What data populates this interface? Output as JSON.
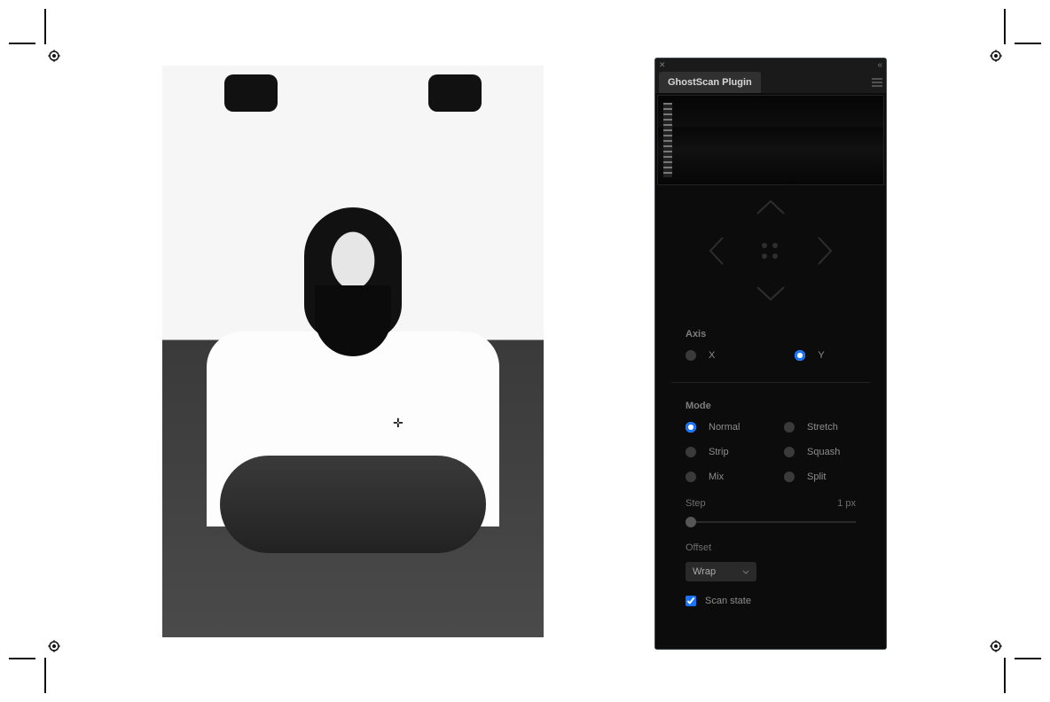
{
  "panel": {
    "title": "GhostScan Plugin",
    "axis": {
      "label": "Axis",
      "options": [
        "X",
        "Y"
      ],
      "selected": "Y"
    },
    "mode": {
      "label": "Mode",
      "options": [
        "Normal",
        "Stretch",
        "Strip",
        "Squash",
        "Mix",
        "Split"
      ],
      "selected": "Normal"
    },
    "step": {
      "label": "Step",
      "value": "1 px"
    },
    "offset": {
      "label": "Offset",
      "selectValue": "Wrap"
    },
    "scanState": {
      "label": "Scan state",
      "checked": true
    }
  }
}
